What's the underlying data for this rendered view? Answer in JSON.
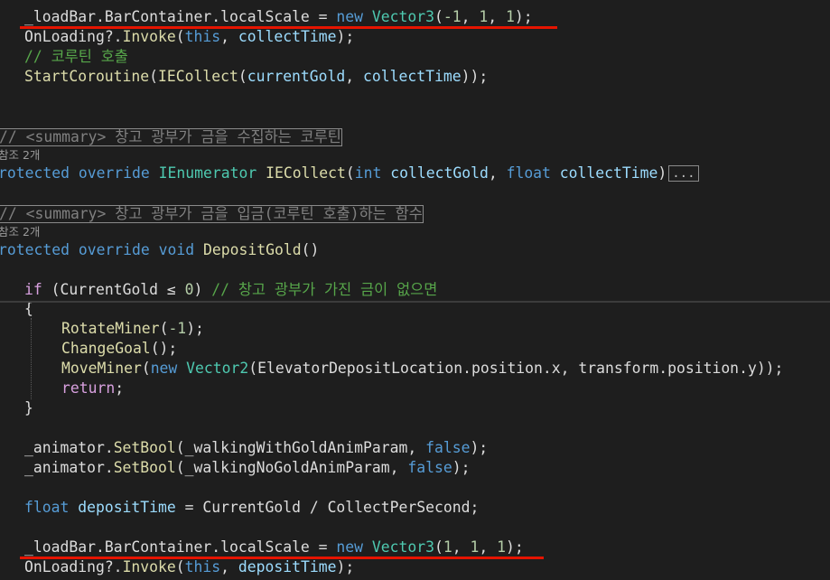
{
  "editor": {
    "lines": [
      {
        "indent": "  ",
        "tokens": [
          {
            "t": "_loadBar",
            "c": "plain"
          },
          {
            "t": ".",
            "c": "plain"
          },
          {
            "t": "BarContainer",
            "c": "plain"
          },
          {
            "t": ".",
            "c": "plain"
          },
          {
            "t": "localScale",
            "c": "plain"
          },
          {
            "t": " = ",
            "c": "plain"
          },
          {
            "t": "new",
            "c": "kw"
          },
          {
            "t": " ",
            "c": "plain"
          },
          {
            "t": "Vector3",
            "c": "type"
          },
          {
            "t": "(",
            "c": "plain"
          },
          {
            "t": "-1",
            "c": "num"
          },
          {
            "t": ", ",
            "c": "plain"
          },
          {
            "t": "1",
            "c": "num"
          },
          {
            "t": ", ",
            "c": "plain"
          },
          {
            "t": "1",
            "c": "num"
          },
          {
            "t": ");",
            "c": "plain"
          }
        ]
      },
      {
        "indent": "  ",
        "tokens": [
          {
            "t": "OnLoading",
            "c": "plain"
          },
          {
            "t": "?.",
            "c": "plain"
          },
          {
            "t": "Invoke",
            "c": "meth"
          },
          {
            "t": "(",
            "c": "plain"
          },
          {
            "t": "this",
            "c": "kw"
          },
          {
            "t": ", ",
            "c": "plain"
          },
          {
            "t": "collectTime",
            "c": "param"
          },
          {
            "t": ");",
            "c": "plain"
          }
        ]
      },
      {
        "indent": "  ",
        "tokens": [
          {
            "t": "// 코루틴 호출",
            "c": "cmt"
          }
        ]
      },
      {
        "indent": "  ",
        "tokens": [
          {
            "t": "StartCoroutine",
            "c": "meth"
          },
          {
            "t": "(",
            "c": "plain"
          },
          {
            "t": "IECollect",
            "c": "meth"
          },
          {
            "t": "(",
            "c": "plain"
          },
          {
            "t": "currentGold",
            "c": "param"
          },
          {
            "t": ", ",
            "c": "plain"
          },
          {
            "t": "collectTime",
            "c": "param"
          },
          {
            "t": "));",
            "c": "plain"
          }
        ]
      },
      {
        "indent": "",
        "tokens": []
      },
      {
        "indent": "",
        "tokens": []
      },
      {
        "indent": "",
        "boxed": true,
        "tokens": [
          {
            "t": "// <summary> 창고 광부가 금을 수집하는 코루틴",
            "c": "gray"
          }
        ]
      },
      {
        "indent": "",
        "ref": true,
        "tokens": [
          {
            "t": "참조 2개",
            "c": "ref"
          }
        ]
      },
      {
        "indent": "",
        "tokens": [
          {
            "t": "rotected",
            "c": "kw"
          },
          {
            "t": " ",
            "c": "plain"
          },
          {
            "t": "override",
            "c": "kw"
          },
          {
            "t": " ",
            "c": "plain"
          },
          {
            "t": "IEnumerator",
            "c": "type"
          },
          {
            "t": " ",
            "c": "plain"
          },
          {
            "t": "IECollect",
            "c": "meth"
          },
          {
            "t": "(",
            "c": "plain"
          },
          {
            "t": "int",
            "c": "kw"
          },
          {
            "t": " ",
            "c": "plain"
          },
          {
            "t": "collectGold",
            "c": "param"
          },
          {
            "t": ", ",
            "c": "plain"
          },
          {
            "t": "float",
            "c": "kw"
          },
          {
            "t": " ",
            "c": "plain"
          },
          {
            "t": "collectTime",
            "c": "param"
          },
          {
            "t": ")",
            "c": "plain"
          },
          {
            "t": "...",
            "c": "ellipsis"
          }
        ]
      },
      {
        "indent": "",
        "tokens": []
      },
      {
        "indent": "",
        "boxed": true,
        "tokens": [
          {
            "t": "// <summary> 창고 광부가 금을 입금(코루틴 호출)하는 함수",
            "c": "gray"
          }
        ]
      },
      {
        "indent": "",
        "ref": true,
        "tokens": [
          {
            "t": "참조 2개",
            "c": "ref"
          }
        ]
      },
      {
        "indent": "",
        "tokens": [
          {
            "t": "rotected",
            "c": "kw"
          },
          {
            "t": " ",
            "c": "plain"
          },
          {
            "t": "override",
            "c": "kw"
          },
          {
            "t": " ",
            "c": "plain"
          },
          {
            "t": "void",
            "c": "kw"
          },
          {
            "t": " ",
            "c": "plain"
          },
          {
            "t": "DepositGold",
            "c": "meth"
          },
          {
            "t": "()",
            "c": "plain"
          }
        ]
      },
      {
        "indent": "",
        "tokens": []
      },
      {
        "indent": "  ",
        "tokens": [
          {
            "t": "if",
            "c": "ctrl"
          },
          {
            "t": " (",
            "c": "plain"
          },
          {
            "t": "CurrentGold",
            "c": "plain"
          },
          {
            "t": " ≤ ",
            "c": "plain"
          },
          {
            "t": "0",
            "c": "num"
          },
          {
            "t": ") ",
            "c": "plain"
          },
          {
            "t": "// 창고 광부가 가진 금이 없으면",
            "c": "cmt"
          }
        ]
      },
      {
        "indent": "  ",
        "tokens": [
          {
            "t": "{",
            "c": "plain"
          }
        ]
      },
      {
        "indent": "    ",
        "tokens": [
          {
            "t": "RotateMiner",
            "c": "meth"
          },
          {
            "t": "(",
            "c": "plain"
          },
          {
            "t": "-1",
            "c": "num"
          },
          {
            "t": ");",
            "c": "plain"
          }
        ]
      },
      {
        "indent": "    ",
        "tokens": [
          {
            "t": "ChangeGoal",
            "c": "meth"
          },
          {
            "t": "();",
            "c": "plain"
          }
        ]
      },
      {
        "indent": "    ",
        "tokens": [
          {
            "t": "MoveMiner",
            "c": "meth"
          },
          {
            "t": "(",
            "c": "plain"
          },
          {
            "t": "new",
            "c": "kw"
          },
          {
            "t": " ",
            "c": "plain"
          },
          {
            "t": "Vector2",
            "c": "type"
          },
          {
            "t": "(",
            "c": "plain"
          },
          {
            "t": "ElevatorDepositLocation",
            "c": "plain"
          },
          {
            "t": ".",
            "c": "plain"
          },
          {
            "t": "position",
            "c": "plain"
          },
          {
            "t": ".",
            "c": "plain"
          },
          {
            "t": "x",
            "c": "plain"
          },
          {
            "t": ", ",
            "c": "plain"
          },
          {
            "t": "transform",
            "c": "plain"
          },
          {
            "t": ".",
            "c": "plain"
          },
          {
            "t": "position",
            "c": "plain"
          },
          {
            "t": ".",
            "c": "plain"
          },
          {
            "t": "y",
            "c": "plain"
          },
          {
            "t": "));",
            "c": "plain"
          }
        ]
      },
      {
        "indent": "    ",
        "tokens": [
          {
            "t": "return",
            "c": "ctrl"
          },
          {
            "t": ";",
            "c": "plain"
          }
        ]
      },
      {
        "indent": "  ",
        "tokens": [
          {
            "t": "}",
            "c": "plain"
          }
        ]
      },
      {
        "indent": "",
        "tokens": []
      },
      {
        "indent": "  ",
        "tokens": [
          {
            "t": "_animator",
            "c": "plain"
          },
          {
            "t": ".",
            "c": "plain"
          },
          {
            "t": "SetBool",
            "c": "meth"
          },
          {
            "t": "(",
            "c": "plain"
          },
          {
            "t": "_walkingWithGoldAnimParam",
            "c": "plain"
          },
          {
            "t": ", ",
            "c": "plain"
          },
          {
            "t": "false",
            "c": "kw"
          },
          {
            "t": ");",
            "c": "plain"
          }
        ]
      },
      {
        "indent": "  ",
        "tokens": [
          {
            "t": "_animator",
            "c": "plain"
          },
          {
            "t": ".",
            "c": "plain"
          },
          {
            "t": "SetBool",
            "c": "meth"
          },
          {
            "t": "(",
            "c": "plain"
          },
          {
            "t": "_walkingNoGoldAnimParam",
            "c": "plain"
          },
          {
            "t": ", ",
            "c": "plain"
          },
          {
            "t": "false",
            "c": "kw"
          },
          {
            "t": ");",
            "c": "plain"
          }
        ]
      },
      {
        "indent": "",
        "tokens": []
      },
      {
        "indent": "  ",
        "tokens": [
          {
            "t": "float",
            "c": "kw"
          },
          {
            "t": " ",
            "c": "plain"
          },
          {
            "t": "depositTime",
            "c": "param"
          },
          {
            "t": " = ",
            "c": "plain"
          },
          {
            "t": "CurrentGold",
            "c": "plain"
          },
          {
            "t": " / ",
            "c": "plain"
          },
          {
            "t": "CollectPerSecond",
            "c": "plain"
          },
          {
            "t": ";",
            "c": "plain"
          }
        ]
      },
      {
        "indent": "",
        "tokens": []
      },
      {
        "indent": "  ",
        "tokens": [
          {
            "t": "_loadBar",
            "c": "plain"
          },
          {
            "t": ".",
            "c": "plain"
          },
          {
            "t": "BarContainer",
            "c": "plain"
          },
          {
            "t": ".",
            "c": "plain"
          },
          {
            "t": "localScale",
            "c": "plain"
          },
          {
            "t": " = ",
            "c": "plain"
          },
          {
            "t": "new",
            "c": "kw"
          },
          {
            "t": " ",
            "c": "plain"
          },
          {
            "t": "Vector3",
            "c": "type"
          },
          {
            "t": "(",
            "c": "plain"
          },
          {
            "t": "1",
            "c": "num"
          },
          {
            "t": ", ",
            "c": "plain"
          },
          {
            "t": "1",
            "c": "num"
          },
          {
            "t": ", ",
            "c": "plain"
          },
          {
            "t": "1",
            "c": "num"
          },
          {
            "t": ");",
            "c": "plain"
          }
        ]
      },
      {
        "indent": "  ",
        "tokens": [
          {
            "t": "OnLoading",
            "c": "plain"
          },
          {
            "t": "?.",
            "c": "plain"
          },
          {
            "t": "Invoke",
            "c": "meth"
          },
          {
            "t": "(",
            "c": "plain"
          },
          {
            "t": "this",
            "c": "kw"
          },
          {
            "t": ", ",
            "c": "plain"
          },
          {
            "t": "depositTime",
            "c": "param"
          },
          {
            "t": ");",
            "c": "plain"
          }
        ]
      }
    ]
  },
  "annotations": {
    "underline_color": "#e51400"
  }
}
